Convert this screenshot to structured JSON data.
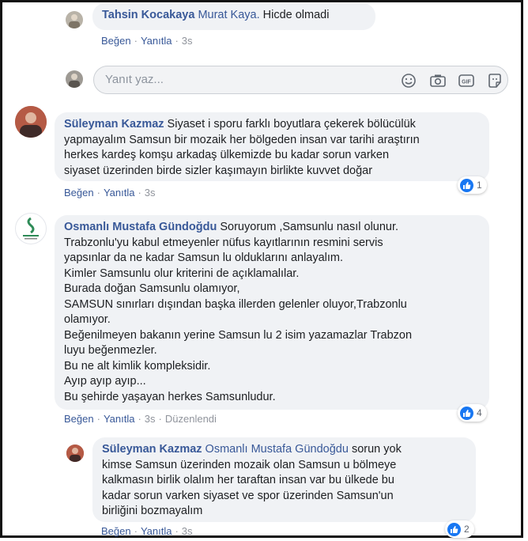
{
  "colors": {
    "link": "#385898",
    "bubble": "#f0f2f5",
    "meta": "#90949c",
    "like": "#1877f2"
  },
  "reply_top": {
    "author": "Tahsin Kocakaya",
    "mention": "Murat Kaya.",
    "text": " Hicde olmadi",
    "like": "Beğen",
    "sep": "·",
    "reply": "Yanıtla",
    "time": "3s"
  },
  "composer": {
    "placeholder": "Yanıt yaz...",
    "icons": [
      "emoji-icon",
      "camera-icon",
      "gif-icon",
      "sticker-icon"
    ]
  },
  "comment1": {
    "author": "Süleyman Kazmaz",
    "lines": [
      " Siyaset i sporu farklı boyutlara çekerek bölücülük",
      "yapmayalım Samsun bir mozaik her bölgeden insan var tarihi araştırın",
      "herkes kardeş komşu arkadaş ülkemizde bu kadar sorun varken",
      "siyaset üzerinden birde sizler kaşımayın birlikte kuvvet doğar"
    ],
    "like": "Beğen",
    "reply": "Yanıtla",
    "time": "3s",
    "sep": "·",
    "reactions": "1"
  },
  "comment2": {
    "author": "Osmanlı Mustafa Gündoğdu",
    "lines": [
      " Soruyorum ,Samsunlu nasıl olunur.",
      "Trabzonlu'yu kabul etmeyenler nüfus kayıtlarının resmini servis",
      "yapsınlar da ne kadar Samsun lu olduklarını anlayalım.",
      "Kimler Samsunlu olur kriterini de açıklamalılar.",
      "Burada doğan Samsunlu olamıyor,",
      "SAMSUN sınırları dışından başka illerden gelenler oluyor,Trabzonlu",
      "olamıyor.",
      "Beğenilmeyen bakanın yerine Samsun lu 2 isim yazamazlar Trabzon",
      "luyu beğenmezler.",
      "Bu ne alt kimlik kompleksidir.",
      "Ayıp ayıp ayıp...",
      "Bu şehirde yaşayan herkes Samsunludur."
    ],
    "like": "Beğen",
    "reply": "Yanıtla",
    "time": "3s",
    "edited": "Düzenlendi",
    "sep": "·",
    "reactions": "4"
  },
  "reply3": {
    "author": "Süleyman Kazmaz",
    "mention": " Osmanlı Mustafa Gündoğdu",
    "lines": [
      " sorun yok",
      "kimse Samsun üzerinden mozaik olan Samsun u bölmeye",
      "kalkmasın birlik olalım her taraftan insan var bu ülkede bu",
      "kadar sorun varken siyaset ve spor üzerinden Samsun'un",
      "birliğini bozmayalım"
    ],
    "like": "Beğen",
    "reply": "Yanıtla",
    "time": "3s",
    "sep": "·",
    "reactions": "2"
  }
}
